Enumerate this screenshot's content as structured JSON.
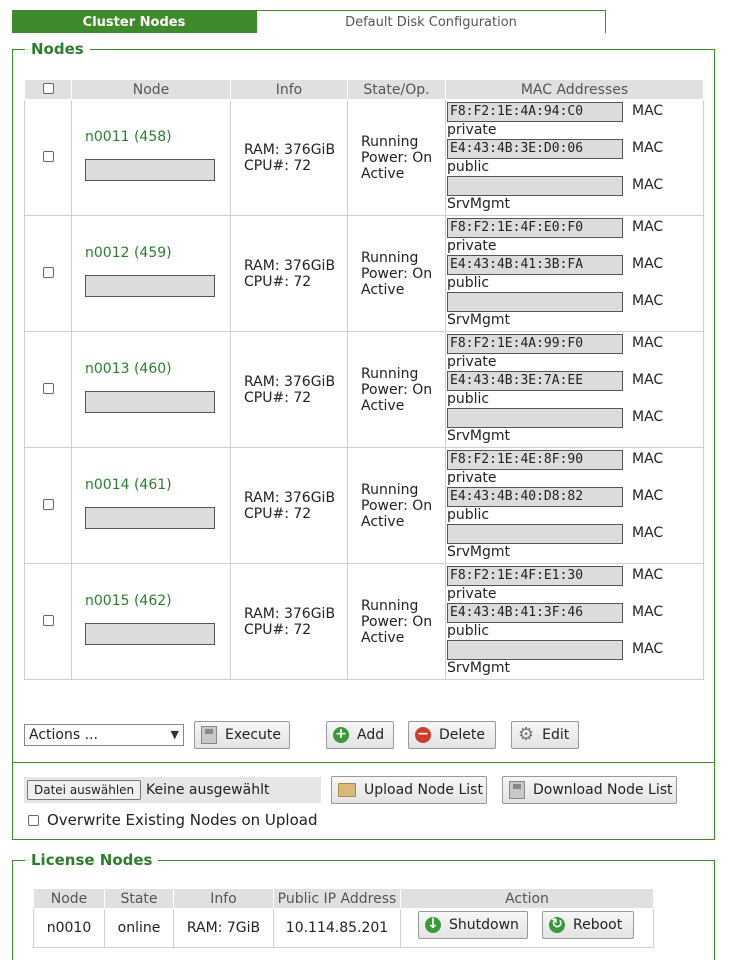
{
  "tabs": {
    "cluster_nodes": "Cluster Nodes",
    "default_disk": "Default Disk Configuration"
  },
  "nodes_section": {
    "legend": "Nodes",
    "columns": {
      "node": "Node",
      "info": "Info",
      "state": "State/Op.",
      "mac": "MAC Addresses"
    },
    "rows": [
      {
        "node": "n0011 (458)",
        "ram": "RAM: 376GiB",
        "cpu": "CPU#: 72",
        "state1": "Running",
        "state2": "Power: On",
        "state3": "Active",
        "macs": [
          {
            "value": "F8:F2:1E:4A:94:C0",
            "type": "MAC",
            "label": "private"
          },
          {
            "value": "E4:43:4B:3E:D0:06",
            "type": "MAC",
            "label": "public"
          },
          {
            "value": "",
            "type": "MAC",
            "label": "SrvMgmt"
          }
        ]
      },
      {
        "node": "n0012 (459)",
        "ram": "RAM: 376GiB",
        "cpu": "CPU#: 72",
        "state1": "Running",
        "state2": "Power: On",
        "state3": "Active",
        "macs": [
          {
            "value": "F8:F2:1E:4F:E0:F0",
            "type": "MAC",
            "label": "private"
          },
          {
            "value": "E4:43:4B:41:3B:FA",
            "type": "MAC",
            "label": "public"
          },
          {
            "value": "",
            "type": "MAC",
            "label": "SrvMgmt"
          }
        ]
      },
      {
        "node": "n0013 (460)",
        "ram": "RAM: 376GiB",
        "cpu": "CPU#: 72",
        "state1": "Running",
        "state2": "Power: On",
        "state3": "Active",
        "macs": [
          {
            "value": "F8:F2:1E:4A:99:F0",
            "type": "MAC",
            "label": "private"
          },
          {
            "value": "E4:43:4B:3E:7A:EE",
            "type": "MAC",
            "label": "public"
          },
          {
            "value": "",
            "type": "MAC",
            "label": "SrvMgmt"
          }
        ]
      },
      {
        "node": "n0014 (461)",
        "ram": "RAM: 376GiB",
        "cpu": "CPU#: 72",
        "state1": "Running",
        "state2": "Power: On",
        "state3": "Active",
        "macs": [
          {
            "value": "F8:F2:1E:4E:8F:90",
            "type": "MAC",
            "label": "private"
          },
          {
            "value": "E4:43:4B:40:D8:82",
            "type": "MAC",
            "label": "public"
          },
          {
            "value": "",
            "type": "MAC",
            "label": "SrvMgmt"
          }
        ]
      },
      {
        "node": "n0015 (462)",
        "ram": "RAM: 376GiB",
        "cpu": "CPU#: 72",
        "state1": "Running",
        "state2": "Power: On",
        "state3": "Active",
        "macs": [
          {
            "value": "F8:F2:1E:4F:E1:30",
            "type": "MAC",
            "label": "private"
          },
          {
            "value": "E4:43:4B:41:3F:46",
            "type": "MAC",
            "label": "public"
          },
          {
            "value": "",
            "type": "MAC",
            "label": "SrvMgmt"
          }
        ]
      }
    ],
    "actions_select": "Actions ...",
    "buttons": {
      "execute": "Execute",
      "add": "Add",
      "delete": "Delete",
      "edit": "Edit"
    },
    "file": {
      "choose": "Datei auswählen",
      "none": "Keine ausgewählt"
    },
    "upload": "Upload Node List",
    "download": "Download Node List",
    "overwrite": "Overwrite Existing Nodes on Upload"
  },
  "license_section": {
    "legend": "License Nodes",
    "columns": {
      "node": "Node",
      "state": "State",
      "info": "Info",
      "ip": "Public IP Address",
      "action": "Action"
    },
    "rows": [
      {
        "node": "n0010",
        "state": "online",
        "info": "RAM: 7GiB",
        "ip": "10.114.85.201"
      }
    ],
    "buttons": {
      "shutdown": "Shutdown",
      "reboot": "Reboot"
    }
  },
  "colors": {
    "accent": "#3f8a2b",
    "link": "#2e7d2e"
  }
}
